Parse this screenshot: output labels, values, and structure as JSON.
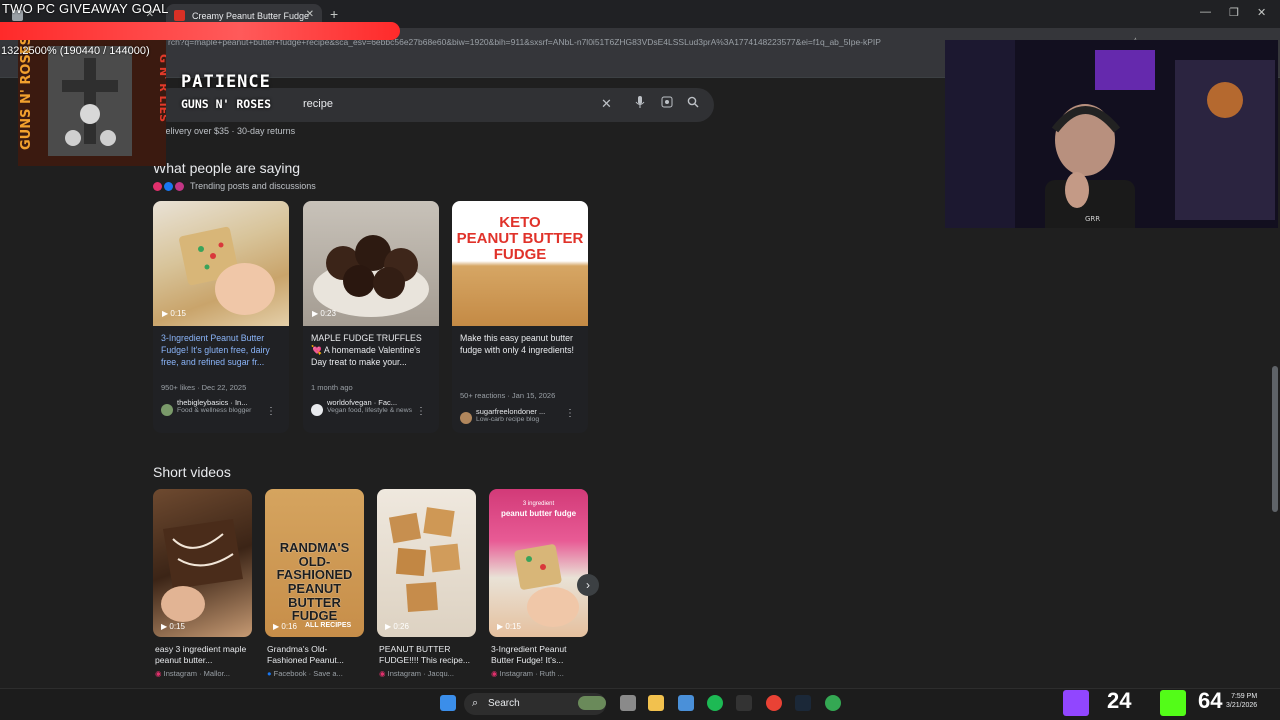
{
  "browser": {
    "tabs": [
      {
        "label": "",
        "active": false
      },
      {
        "label": "Creamy Peanut Butter Fudge",
        "active": true
      }
    ],
    "url": "rch?q=maple+peanut+butter+fudge+recipe&sca_esv=6ebbc56e27b68e60&biw=1920&bih=911&sxsrf=ANbL-n7l0i51T6ZHG83VDsE4LSSLud3prA%3A1774148223577&ei=f1q_ab_5Ipe-kPIP"
  },
  "search": {
    "query_visible": "recipe"
  },
  "shipping_note": "e delivery over $35 · 30-day returns",
  "sections": {
    "people_title": "What people are saying",
    "people_sub": "Trending posts and discussions",
    "short_title": "Short videos"
  },
  "posts": [
    {
      "duration": "0:15",
      "caption": "3-Ingredient Peanut Butter Fudge! It's gluten free, dairy free, and refined sugar fr...",
      "meta": "950+ likes · Dec 22, 2025",
      "author": "thebigleybasics · In...",
      "author_sub": "Food & wellness blogger"
    },
    {
      "duration": "0:23",
      "caption": "MAPLE FUDGE TRUFFLES 💘 A homemade Valentine's Day treat to make your...",
      "meta": "1 month ago",
      "author": "worldofvegan · Fac...",
      "author_sub": "Vegan food, lifestyle & news"
    },
    {
      "duration": "",
      "caption": "Make this easy peanut butter fudge with only 4 ingredients!",
      "meta": "50+ reactions · Jan 15, 2026",
      "author": "sugarfreelondoner ...",
      "author_sub": "Low-carb recipe blog",
      "thumb_title_1": "KETO",
      "thumb_title_2": "PEANUT BUTTER",
      "thumb_title_3": "FUDGE"
    }
  ],
  "videos": [
    {
      "duration": "0:15",
      "caption": "easy 3 ingredient maple peanut butter...",
      "source": "Instagram · Mallor..."
    },
    {
      "duration": "0:16",
      "caption": "Grandma's Old-Fashioned Peanut...",
      "source": "Facebook · Save a...",
      "thumb_text": "RANDMA'S OLD-FASHIONED PEANUT BUTTER FUDGE",
      "thumb_small": "ALL RECIPES"
    },
    {
      "duration": "0:26",
      "caption": "PEANUT BUTTER FUDGE!!!! This recipe...",
      "source": "Instagram · Jacqu..."
    },
    {
      "duration": "0:15",
      "caption": "3-Ingredient Peanut Butter Fudge! It's...",
      "source": "Instagram · Ruth ...",
      "thumb_text": "peanut butter fudge",
      "thumb_small": "3 ingredient"
    }
  ],
  "overlay": {
    "goal_title": "TWO PC GIVEAWAY GOAL",
    "goal_progress": 1.322,
    "goal_text": "132.2500% (190440 / 144000)",
    "song_title": "PATIENCE",
    "song_artist": "GUNS N' ROSES",
    "album_text": "GUNS N' ROSES",
    "album_side": "G N' R LIES",
    "webcam_text": "GRR"
  },
  "taskbar": {
    "search_label": "Search",
    "counter_left": "24",
    "counter_right": "64",
    "time": "7:59 PM",
    "date": "3/21/2026"
  },
  "colors": {
    "accent_link": "#8ab4f8",
    "goal_bar": "#ff2a2a",
    "page_bg": "#1f1f1f"
  }
}
